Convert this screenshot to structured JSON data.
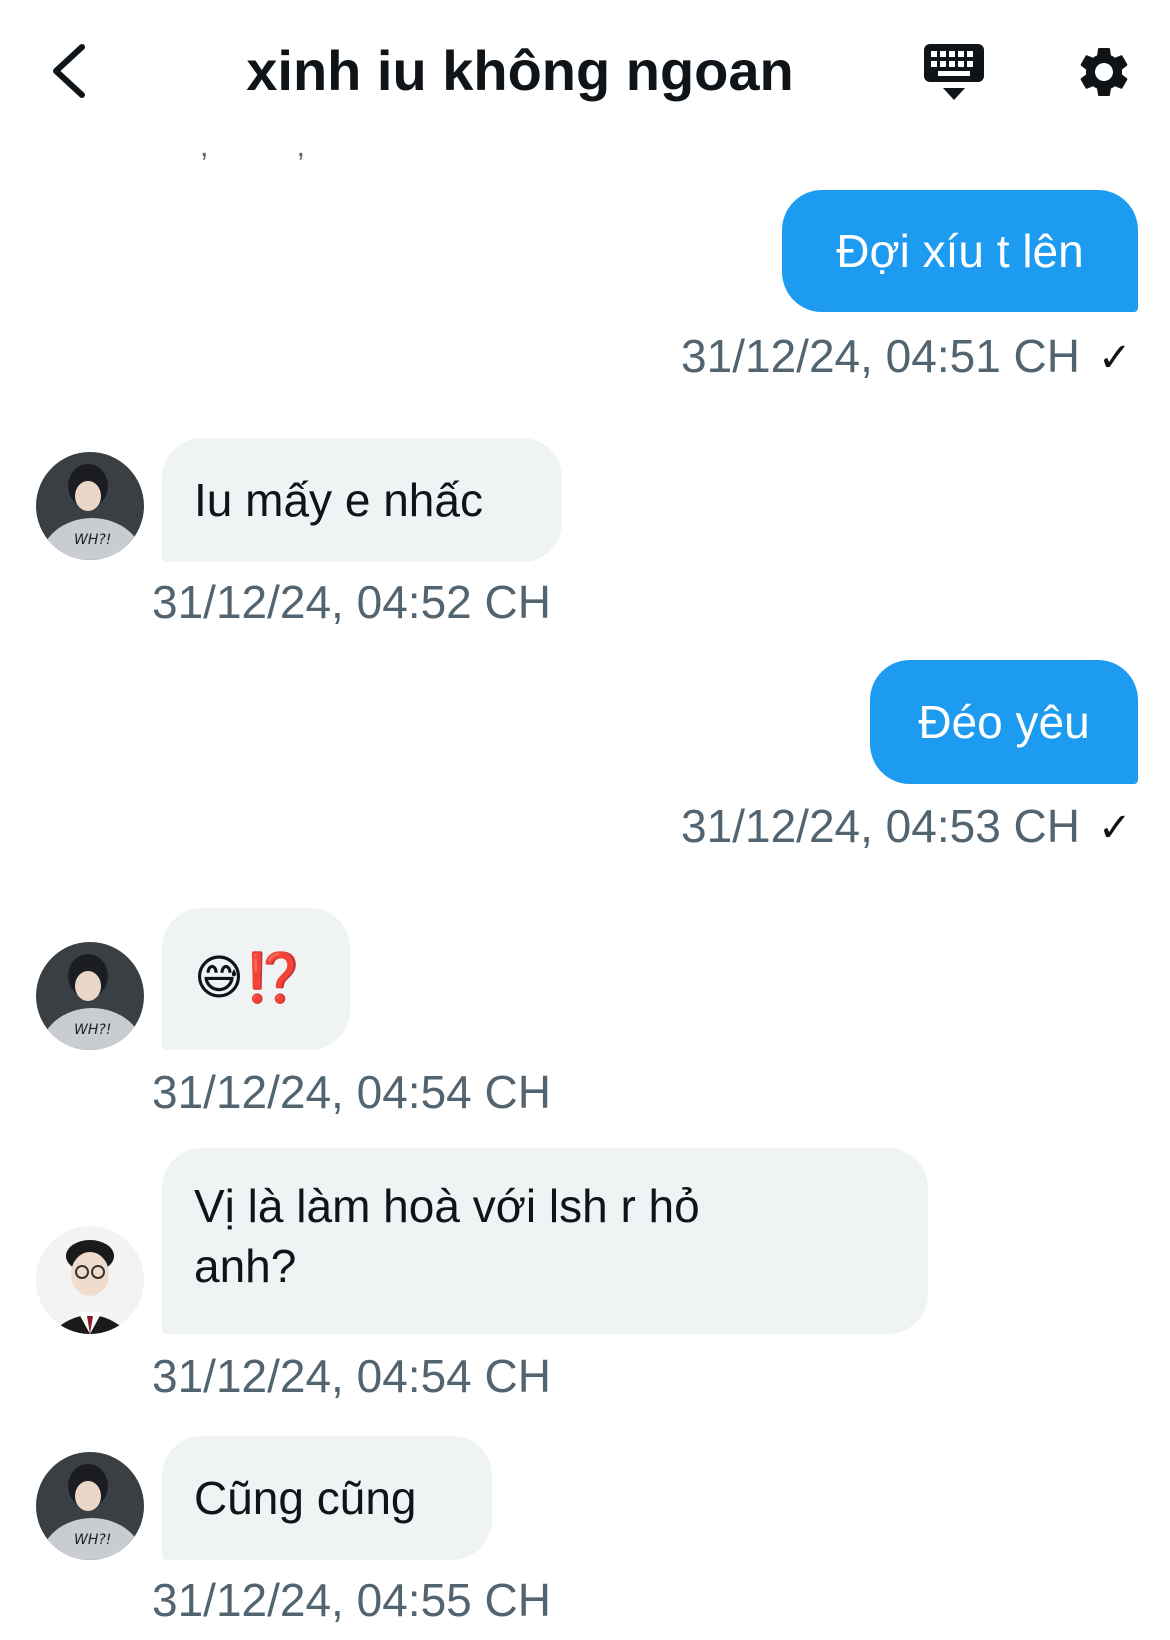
{
  "header": {
    "title": "xinh iu không ngoan",
    "cut_text": ", , ,"
  },
  "messages": [
    {
      "direction": "outgoing",
      "text": "Đợi xíu t lên",
      "timestamp": "31/12/24, 04:51 CH",
      "read_mark": "✓"
    },
    {
      "direction": "incoming",
      "text": "Iu mấy e nhấc",
      "timestamp": "31/12/24, 04:52 CH",
      "avatar": "avatar-hoodie"
    },
    {
      "direction": "outgoing",
      "text": "Đéo yêu",
      "timestamp": "31/12/24, 04:53 CH",
      "read_mark": "✓"
    },
    {
      "direction": "incoming",
      "text": "😅⁉️",
      "timestamp": "31/12/24, 04:54 CH",
      "avatar": "avatar-hoodie"
    },
    {
      "direction": "incoming",
      "text": "Vị là làm hoà với lsh r hỏ anh?",
      "timestamp": "31/12/24, 04:54 CH",
      "avatar": "avatar-glasses"
    },
    {
      "direction": "incoming",
      "text": "Cũng cũng",
      "timestamp": "31/12/24, 04:55 CH",
      "avatar": "avatar-hoodie"
    }
  ],
  "icons": {
    "back": "chevron-left-icon",
    "keyboard": "keyboard-icon",
    "settings": "gear-icon"
  },
  "colors": {
    "outgoing_bubble": "#1d9bf0",
    "incoming_bubble": "#eff3f4",
    "timestamp": "#536471"
  }
}
